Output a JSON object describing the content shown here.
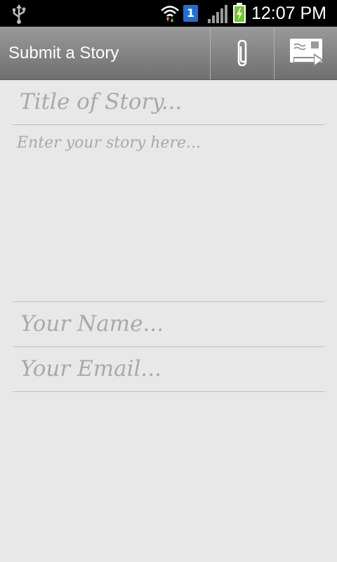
{
  "status_bar": {
    "time": "12:07 PM",
    "sim_slot": "1",
    "icons": [
      "usb-icon",
      "wifi-icon",
      "sim-icon",
      "signal-icon",
      "battery-charging-icon"
    ]
  },
  "action_bar": {
    "title": "Submit a Story",
    "actions": [
      "attach-icon",
      "send-message-icon"
    ]
  },
  "form": {
    "title_placeholder": "Title of Story...",
    "story_placeholder": "Enter your story here...",
    "name_placeholder": "Your Name...",
    "email_placeholder": "Your Email..."
  },
  "colors": {
    "background": "#e8e8e8",
    "action_bar": "#858585",
    "placeholder": "#a9a9a9"
  }
}
